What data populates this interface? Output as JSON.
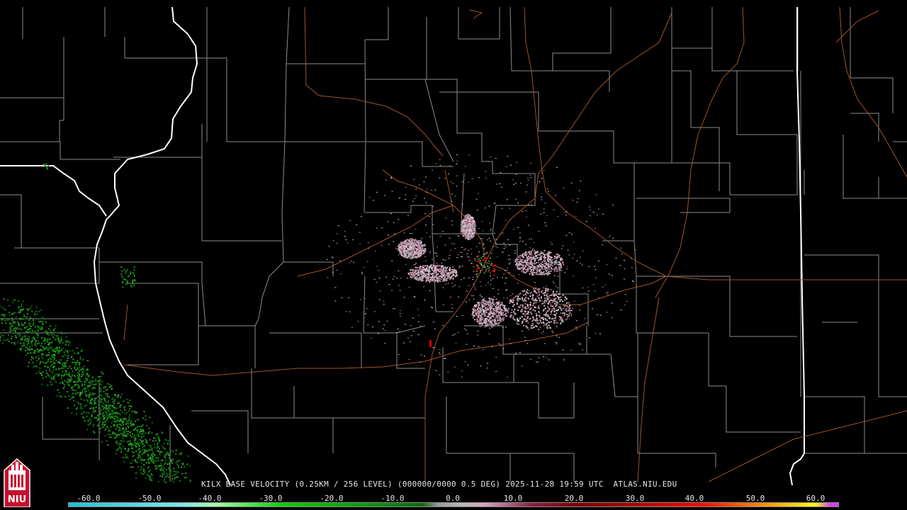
{
  "caption": {
    "text": "KILX BASE VELOCITY (0.25KM / 256 LEVEL) (000000/0000 0.5 DEG) 2025-11-28 19:59 UTC  ATLAS.NIU.EDU"
  },
  "color_scale": {
    "labels": [
      "-60.0",
      "-50.0",
      "-40.0",
      "-30.0",
      "-20.0",
      "-10.0",
      "0.0",
      "10.0",
      "20.0",
      "30.0",
      "40.0",
      "50.0",
      "60.0"
    ],
    "colors": {
      "cyan": "#19c4d8",
      "light_green": "#a6ffa6",
      "green": "#00d000",
      "dark_green": "#0b6b0b",
      "gray": "#9a9a9a",
      "pink": "#d8a8c0",
      "dark_red": "#7a0000",
      "red": "#ff0000",
      "orange": "#ff8c00",
      "yellow": "#ffff00",
      "magenta": "#d040f0"
    }
  },
  "logo": {
    "text": "NIU"
  },
  "map_colors": {
    "county_lines": "#8c8c8c",
    "state_lines": "#ffffff",
    "highways": "#a0522d",
    "inbound_velocity": "#1f8f1f",
    "outbound_velocity": "#e0a0c0"
  }
}
